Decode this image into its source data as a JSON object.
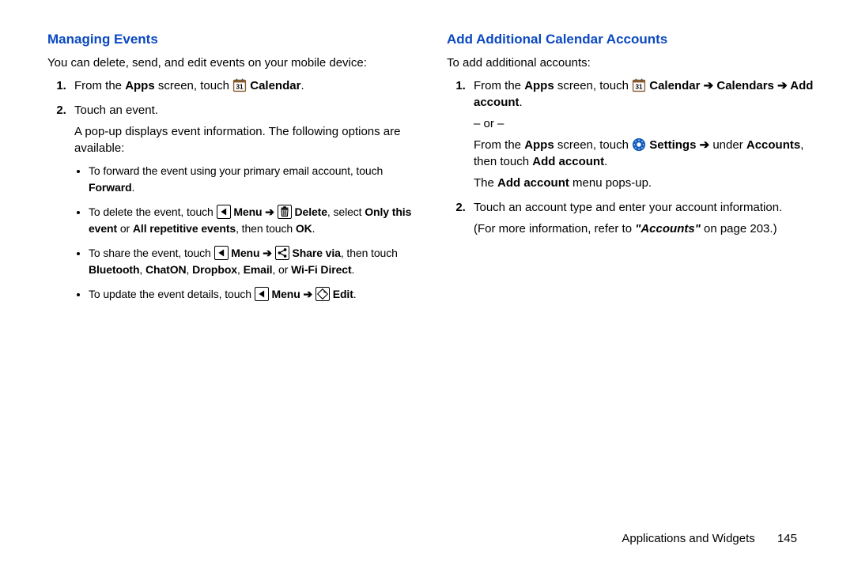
{
  "left": {
    "title": "Managing Events",
    "intro": "You can delete, send, and edit events on your mobile device:",
    "step1_a": "From the ",
    "step1_apps": "Apps",
    "step1_b": " screen, touch ",
    "step1_cal": " Calendar",
    "step1_c": ".",
    "step2_a": "Touch an event.",
    "step2_b": "A pop-up displays event information. The following options are available:",
    "bullet1_a": "To forward the event using your primary email account, touch ",
    "bullet1_fwd": "Forward",
    "bullet1_b": ".",
    "bullet2_a": "To delete the event, touch ",
    "bullet2_menu": " Menu ",
    "bullet2_del": " Delete",
    "bullet2_b": ", select ",
    "bullet2_only": "Only this event",
    "bullet2_or": " or ",
    "bullet2_all": "All repetitive events",
    "bullet2_c": ", then touch ",
    "bullet2_ok": "OK",
    "bullet2_d": ".",
    "bullet3_a": "To share the event, touch ",
    "bullet3_menu": " Menu ",
    "bullet3_share": " Share via",
    "bullet3_b": ", then touch ",
    "bullet3_bt": "Bluetooth",
    "bullet3_c1": ", ",
    "bullet3_chat": "ChatON",
    "bullet3_c2": ", ",
    "bullet3_db": "Dropbox",
    "bullet3_c3": ", ",
    "bullet3_em": "Email",
    "bullet3_c4": ", or ",
    "bullet3_wifi": "Wi-Fi Direct",
    "bullet3_d": ".",
    "bullet4_a": "To update the event details, touch ",
    "bullet4_menu": " Menu ",
    "bullet4_edit": " Edit",
    "bullet4_b": "."
  },
  "right": {
    "title": "Add Additional Calendar Accounts",
    "intro": "To add additional accounts:",
    "step1_a": "From the ",
    "step1_apps": "Apps",
    "step1_b": " screen, touch ",
    "step1_cal": " Calendar ",
    "step1_cals": "Calendars ",
    "step1_add": " Add account",
    "step1_d": ".",
    "step1_or": "– or –",
    "step1_e": "From the ",
    "step1_apps2": "Apps",
    "step1_f": " screen, touch ",
    "step1_set": " Settings ",
    "step1_under": " under ",
    "step1_acc": "Accounts",
    "step1_g": ", then touch ",
    "step1_add2": "Add account",
    "step1_h": ".",
    "step1_i": "The ",
    "step1_add3": "Add account",
    "step1_j": " menu pops-up.",
    "step2_a": "Touch an account type and enter your account information.",
    "step2_b": "(For more information, refer to ",
    "step2_ref": "\"Accounts\"",
    "step2_c": " on page 203.)"
  },
  "arrow": "➔",
  "footer": {
    "chapter": "Applications and Widgets",
    "page": "145"
  }
}
